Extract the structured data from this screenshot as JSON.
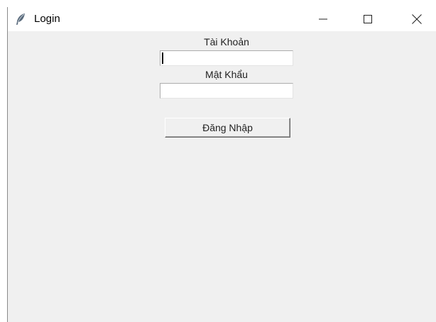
{
  "window": {
    "title": "Login",
    "app_icon": "feather-icon",
    "controls": [
      "minimize-icon",
      "maximize-icon",
      "close-icon"
    ]
  },
  "form": {
    "username_label": "Tài Khoản",
    "username_value": "",
    "password_label": "Mật Khẩu",
    "password_value": "",
    "login_button": "Đăng Nhập"
  },
  "colors": {
    "background": "#f0f0f0",
    "titlebar": "#ffffff",
    "entry": "#ffffff"
  }
}
